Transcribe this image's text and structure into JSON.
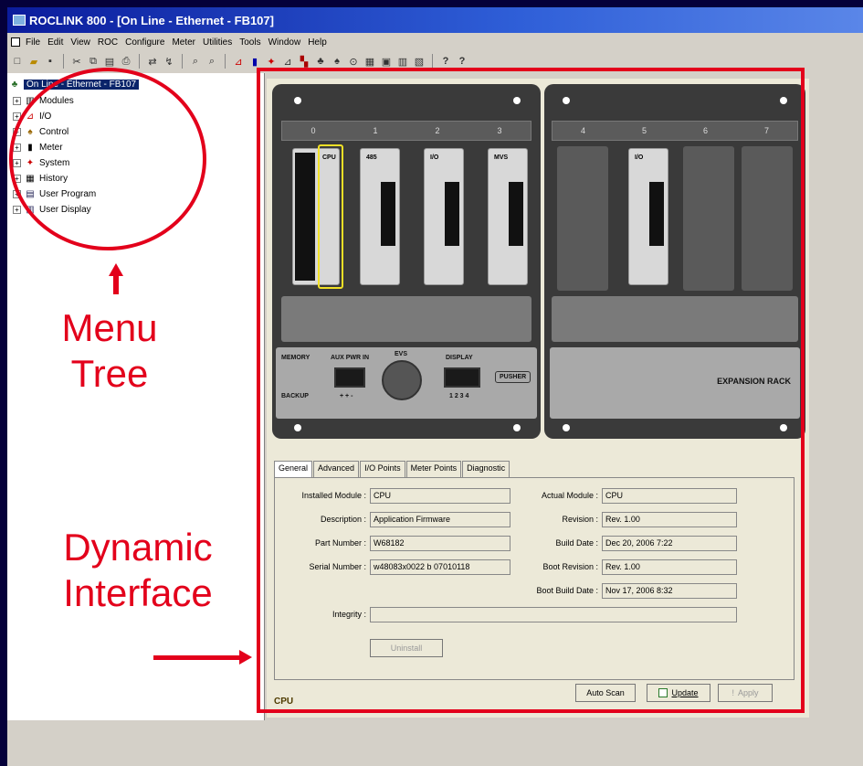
{
  "window": {
    "title": "ROCLINK 800 - [On Line - Ethernet - FB107]"
  },
  "menu": [
    "File",
    "Edit",
    "View",
    "ROC",
    "Configure",
    "Meter",
    "Utilities",
    "Tools",
    "Window",
    "Help"
  ],
  "tree": {
    "root": "On Line - Ethernet - FB107",
    "items": [
      "Modules",
      "I/O",
      "Control",
      "Meter",
      "System",
      "History",
      "User Program",
      "User Display"
    ]
  },
  "annotations": {
    "menu_tree_line1": "Menu",
    "menu_tree_line2": "Tree",
    "dynamic_line1": "Dynamic",
    "dynamic_line2": "Interface"
  },
  "rack_main": {
    "slots": [
      "0",
      "1",
      "2",
      "3"
    ],
    "modules": [
      "CPU",
      "485",
      "I/O",
      "MVS"
    ],
    "front_labels": {
      "memory": "MEMORY",
      "backup": "BACKUP",
      "aux": "AUX PWR IN",
      "aux_pins": "+ + -",
      "ew": "EVS",
      "display": "DISPLAY",
      "display_pins": "1 2 3 4",
      "pusher": "PUSHER"
    }
  },
  "rack_exp": {
    "slots": [
      "4",
      "5",
      "6",
      "7"
    ],
    "modules": [
      "I/O"
    ],
    "label": "EXPANSION RACK"
  },
  "tabs": [
    "General",
    "Advanced",
    "I/O Points",
    "Meter Points",
    "Diagnostic"
  ],
  "general": {
    "installed_module_label": "Installed Module :",
    "installed_module": "CPU",
    "description_label": "Description :",
    "description": "Application Firmware",
    "part_number_label": "Part Number :",
    "part_number": "W68182",
    "serial_number_label": "Serial Number :",
    "serial_number": "w48083x0022 b 07010118",
    "actual_module_label": "Actual Module :",
    "actual_module": "CPU",
    "revision_label": "Revision :",
    "revision": "Rev. 1.00",
    "build_date_label": "Build Date :",
    "build_date": "Dec 20, 2006  7:22",
    "boot_revision_label": "Boot Revision :",
    "boot_revision": "Rev. 1.00",
    "boot_build_date_label": "Boot Build Date :",
    "boot_build_date": "Nov 17, 2006  8:32",
    "integrity_label": "Integrity :",
    "integrity": "",
    "uninstall_label": "Uninstall"
  },
  "footer": {
    "status": "CPU",
    "auto_scan": "Auto Scan",
    "update": "Update",
    "apply": "Apply"
  },
  "colors": {
    "annotation": "#e3001b",
    "cpu_highlight": "#f1e027",
    "title_bar": "#0b1c9c"
  }
}
